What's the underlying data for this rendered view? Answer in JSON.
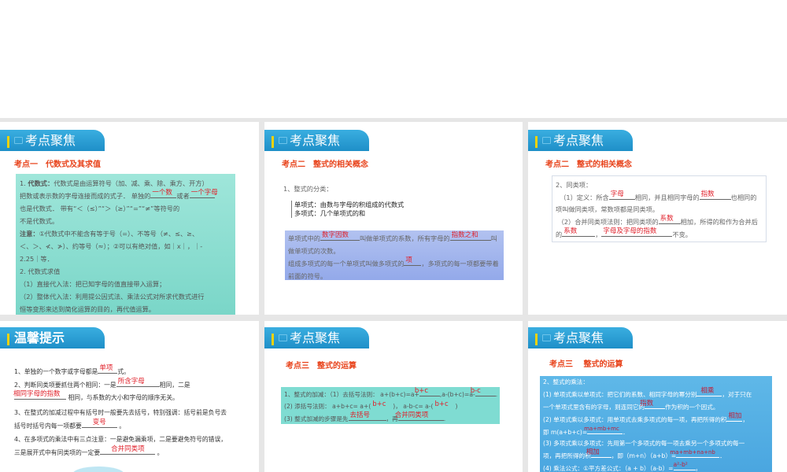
{
  "header_title": "考点聚焦",
  "tip_title": "温馨提示",
  "s1": {
    "sub": "考点一　代数式及其求值",
    "l1a": "1.  ",
    "l1b": "代数式：",
    "l1c": "代数式是由运算符号（加、减、乘、除、乘方、开方）",
    "l2a": "把数或表示数的字母连接而成的式子．  单独的",
    "a1": "一个数",
    "l2b": "或者",
    "a2": "一个字母",
    "l3": "也是代数式．  带有“＜（≤）”“＞（≥）”“=”“≠”等符号的",
    "l4": "不是代数式。",
    "l5a": "注意：",
    "l5b": "①代数式中不能含有等于号（=）、不等号（≠、≤、≥、",
    "l6": "＜、＞、≮、≯）、约等号（≈）；②可以有绝对值，如｜x｜，｜-",
    "l7": "2.25｜等．",
    "l8": "2. 代数式求值",
    "l9": "（1）直接代入法：把已知字母的值直接带入运算；",
    "l10": "（2）整体代入法：利用提公因式法、乘法公式对所求代数式进行",
    "l11": "恒等变形来达到简化运算的目的，再代值运算。"
  },
  "s2": {
    "sub": "考点二　整式的相关概念",
    "l1": "1、整式的分类：",
    "c1": "单项式：由数与字母的积组成的代数式",
    "c2": "多项式：几个单项式的和",
    "b1a": "单项式中的",
    "a1": "数字因数",
    "b1b": "叫做单项式的系数，所有字母的",
    "a2": "指数之和",
    "b1c": "叫",
    "b2": "做单项式的次数。",
    "b3a": "组成多项式的每一个单项式叫做多项式的",
    "a3": "项",
    "b3b": "，多项式的每一项都要带着",
    "b4": "前面的符号。"
  },
  "s3": {
    "sub": "考点二　整式的相关概念",
    "l1": "2、同类项：",
    "l2a": "（1）定义：所含",
    "a1": "字母",
    "l2b": "相同，并且相同字母的",
    "a2": "指数",
    "l2c": "也相同的",
    "l3": "项叫做同类项，常数项都是同类项。",
    "l4a": "（2）合并同类项法则：把同类项的",
    "a3": "系数",
    "l4b": "相加，所得的和作为合并后",
    "l5a": "的",
    "a4": "系数",
    "l5b": "，",
    "a5": "字母及字母的指数",
    "l5c": "不变。"
  },
  "s4": {
    "l1a": "1、单独的一个数字或字母都是",
    "a1": "单项",
    "l1b": "式。",
    "l2a": "2、判断同类项要抓住两个相同：一是",
    "a2": "所含字母",
    "l2b": "相同，二是",
    "a3": "相同字母的指数",
    "l3b": "相同，与系数的大小和字母的顺序无关。",
    "l4": "3、在整式的加减过程中有括号时一般要先去括号，特别强调：括号前是负号去",
    "l5a": "括号时括号内每一项都要",
    "a4": "变号",
    "l5b": "。",
    "l6": "4、在多项式的乘法中有三点注意：一是避免漏乘项，二是要避免符号的错误，",
    "l7a": "三是展开式中有同类项的一定要",
    "a5": "合并同类项",
    "l7b": "。"
  },
  "s5": {
    "sub": "考点三　整式的运算",
    "l1a": "1、整式的加减：（1）去括号法则：  a+(b+c)=a+",
    "a1": "b+c",
    "l1b": ",a-(b+c)=a-",
    "a2": "b-c",
    "l1c": ".",
    "l2a": "(2) 添括号法则：  a+b+c= a+(",
    "a3": "b+c",
    "l2b": ")，  a-b-c= a-(",
    "a4": "b+c",
    "l2c": ")",
    "l3a": "(3) 整式加减的步骤是先",
    "a5": "去括号",
    "l3b": "，再",
    "a6": "合并同类项",
    "l3c": "."
  },
  "s6": {
    "sub": "考点三　 整式的运算",
    "l1": "2、整式的乘法：",
    "l2a": "(1) 单项式乘以单项式：把它们的系数、相同字母的幂分别",
    "a1": "相乘",
    "l2b": "，对于只在",
    "l3a": "一个单项式里含有的字母，则连同它的",
    "a2": "指数",
    "l3b": "作为积的一个因式。",
    "l4a": "(2) 单项式乘以多项式：用单项式去乘多项式的每一项，再把所得的积",
    "a3": "相加",
    "l4b": "，",
    "l5a": "即 m(a+b+c)=",
    "a4": "ma+mb+mc",
    "l5b": "．",
    "l6": "(3) 多项式乘以多项式：先用第一个多项式的每一项去乘另一个多项式的每一",
    "l7a": "项，再把所得的积",
    "a5": "相加",
    "l7b": "，即（m+n）（a+b）=",
    "a6": "ma+mb+na+nb",
    "l7c": "．",
    "l8a": "(4) 乘法公式：①平方差公式：（a + b）（a-b）=",
    "a7": "a²-b²",
    "l8b": "，"
  }
}
